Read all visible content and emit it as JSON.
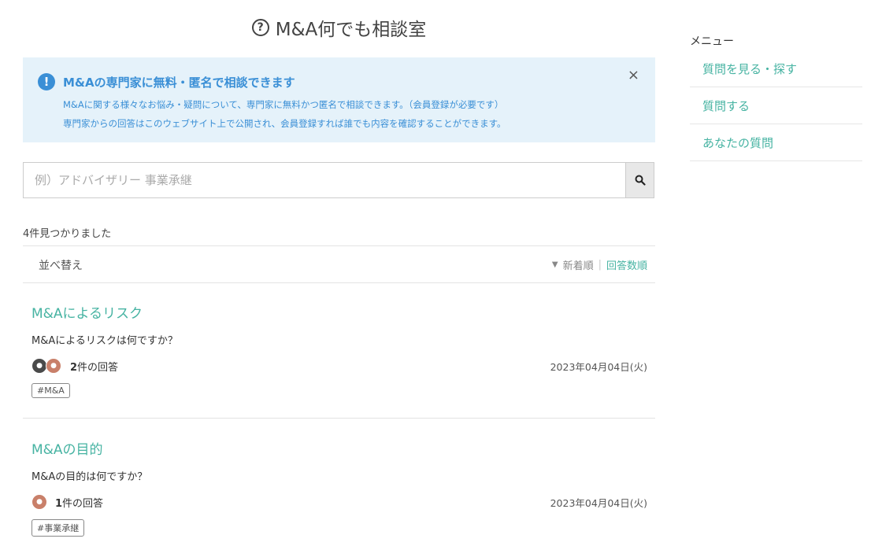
{
  "page": {
    "title": "M&A何でも相談室"
  },
  "notice": {
    "title": "M&Aの専門家に無料・匿名で相談できます",
    "line1": "M&Aに関する様々なお悩み・疑問について、専門家に無料かつ匿名で相談できます。（会員登録が必要です）",
    "line2": "専門家からの回答はこのウェブサイト上で公開され、会員登録すれば誰でも内容を確認することができます。",
    "close": "×"
  },
  "search": {
    "placeholder": "例）アドバイザリー 事業承継",
    "value": ""
  },
  "results": {
    "count_text": "4件見つかりました"
  },
  "sort": {
    "label": "並べ替え",
    "options": [
      "新着順",
      "回答数順"
    ],
    "active": "新着順"
  },
  "questions": [
    {
      "title": "M&Aによるリスク",
      "text": "M&Aによるリスクは何ですか？",
      "answers_count": "2",
      "answers_suffix": "件の回答",
      "date": "2023年04月04日(火)",
      "tag": "#M&A",
      "avatars": [
        "#4a4a4a",
        "#c9806a"
      ]
    },
    {
      "title": "M&Aの目的",
      "text": "M&Aの目的は何ですか？",
      "answers_count": "1",
      "answers_suffix": "件の回答",
      "date": "2023年04月04日(火)",
      "tag": "#事業承継",
      "avatars": [
        "#c9806a"
      ]
    }
  ],
  "sidebar": {
    "heading": "メニュー",
    "items": [
      {
        "label": "質問を見る・探す"
      },
      {
        "label": "質問する"
      },
      {
        "label": "あなたの質問"
      }
    ]
  },
  "colors": {
    "accent": "#46b3a2",
    "info": "#3a8fd6",
    "notice_bg": "#e5f2fa"
  }
}
